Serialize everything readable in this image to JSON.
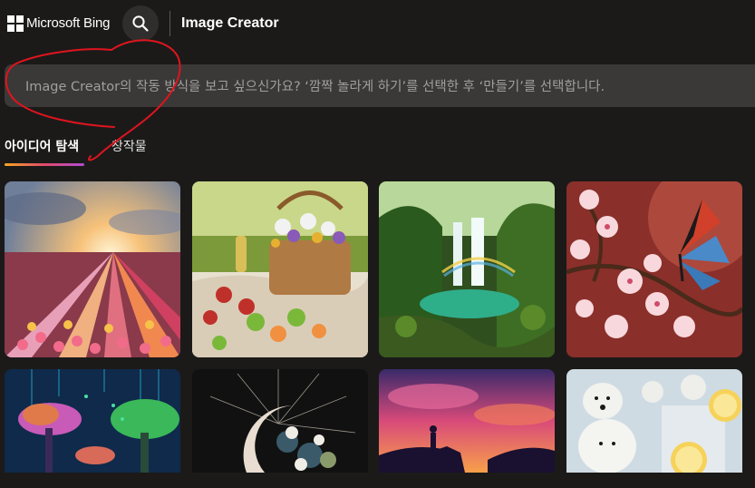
{
  "header": {
    "brand": "Microsoft Bing",
    "app_title": "Image Creator",
    "search_icon": "search-icon",
    "logo_icon": "microsoft-logo-icon"
  },
  "prompt": {
    "placeholder": "Image Creator의 작동 방식을 보고 싶으신가요? ‘깜짝 놀라게 하기’를 선택한 후 ‘만들기’를 선택합니다."
  },
  "tabs": [
    {
      "label": "아이디어 탐색",
      "active": true
    },
    {
      "label": "창작물",
      "active": false
    }
  ],
  "colors": {
    "background": "#1b1a19",
    "prompt_background": "#3a3938",
    "annotation": "#e0141e",
    "tab_underline": [
      "#f5a623",
      "#e04a6a",
      "#b14bd1"
    ]
  },
  "gallery": {
    "images": [
      {
        "name": "tulip-field-sunset"
      },
      {
        "name": "picnic-basket-fruit"
      },
      {
        "name": "waterfall-rainbow"
      },
      {
        "name": "butterfly-cherry-blossom"
      },
      {
        "name": "neon-trees"
      },
      {
        "name": "crescent-moon-flowers"
      },
      {
        "name": "horse-rider-sunset"
      },
      {
        "name": "polar-bears-lemonade"
      }
    ]
  }
}
